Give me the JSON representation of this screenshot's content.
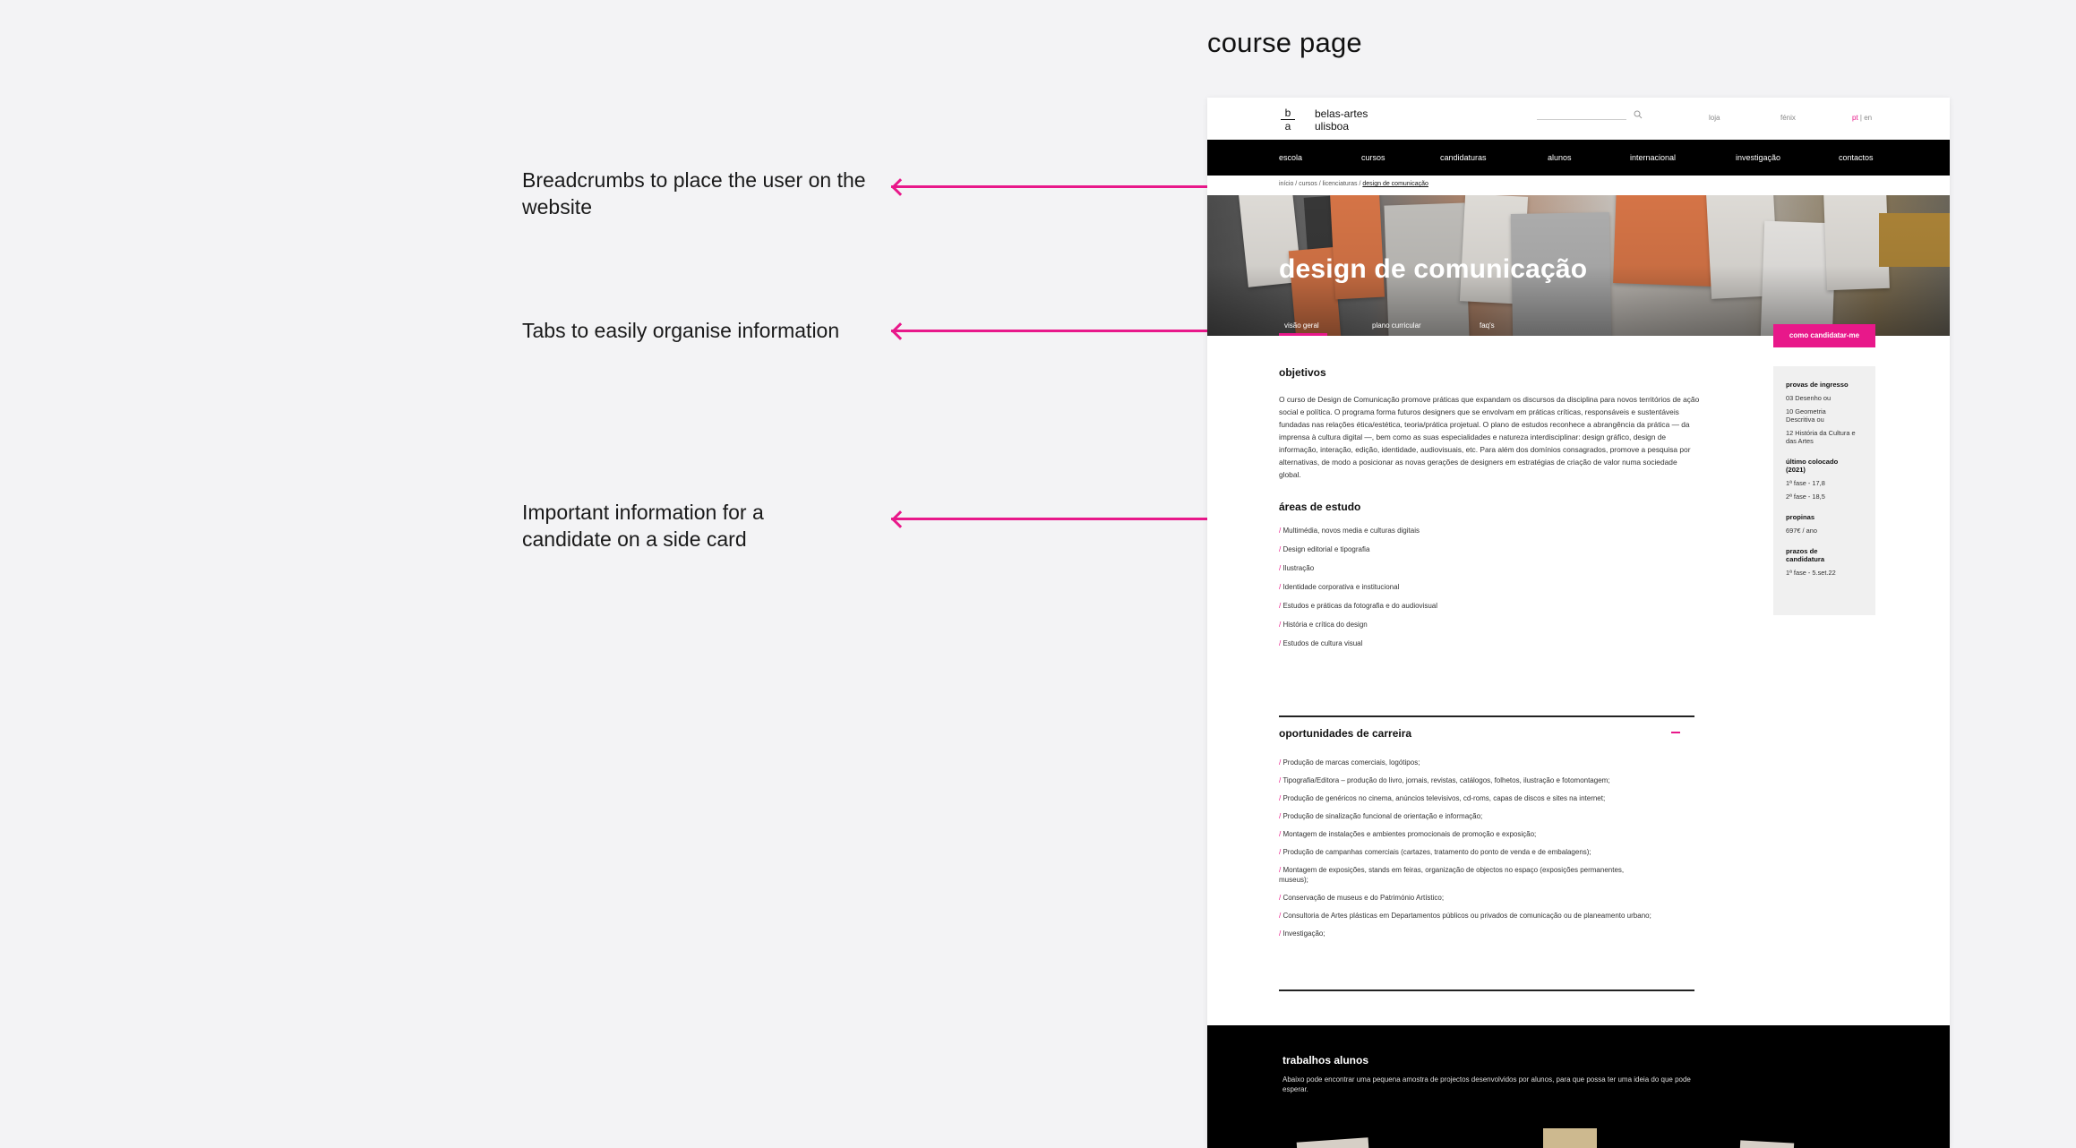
{
  "page_title": "course page",
  "annotations": [
    {
      "text": "Breadcrumbs to place the user on the website"
    },
    {
      "text": "Tabs to easily organise information"
    },
    {
      "text": "Important information for a candidate on a side card"
    }
  ],
  "colors": {
    "accent": "#e8188a",
    "nav_bg": "#000000",
    "page_bg": "#f3f3f5"
  },
  "site": {
    "logo_top": "b",
    "logo_bottom": "a",
    "brand_line1": "belas-artes",
    "brand_line2": "ulisboa",
    "top_links": [
      "loja",
      "fénix"
    ],
    "lang_active": "pt",
    "lang_sep": "|",
    "lang_other": "en"
  },
  "nav": [
    "escola",
    "cursos",
    "candidaturas",
    "alunos",
    "internacional",
    "investigação",
    "contactos"
  ],
  "breadcrumb": {
    "path": "início / cursos / licenciaturas / ",
    "current": "design de comunicação"
  },
  "hero": {
    "title": "design de comunicação",
    "tabs": [
      "visão geral",
      "plano curricular",
      "faq's"
    ],
    "cta": "como candidatar-me"
  },
  "objetivos": {
    "heading": "objetivos",
    "text": "O curso de Design de Comunicação promove práticas que expandam os discursos da disciplina para novos territórios de ação social e política. O programa forma futuros designers que se envolvam em práticas críticas, responsáveis e sustentáveis fundadas nas relações ética/estética, teoria/prática projetual. O plano de estudos reconhece a abrangência da prática — da imprensa à cultura digital —, bem como as suas especialidades e natureza interdisciplinar: design gráfico, design de informação, interação, edição, identidade, audiovisuais, etc. Para além dos domínios consagrados, promove a pesquisa por alternativas, de modo a posicionar as novas gerações de designers em estratégias de criação de valor numa sociedade global."
  },
  "areas": {
    "heading": "áreas de estudo",
    "items": [
      "Multimédia, novos media e culturas digitais",
      "Design editorial e tipografia",
      "Ilustração",
      "Identidade corporativa e institucional",
      "Estudos e práticas da fotografia e do audiovisual",
      "História e crítica do design",
      "Estudos de cultura visual"
    ]
  },
  "carreira": {
    "heading": "oportunidades de carreira",
    "items": [
      "Produção de marcas comerciais, logótipos;",
      "Tipografia/Editora – produção do livro, jornais, revistas, catálogos, folhetos, ilustração e fotomontagem;",
      "Produção de genéricos no cinema, anúncios televisivos, cd-roms, capas de discos e sites na internet;",
      "Produção de sinalização funcional de orientação e informação;",
      "Montagem de instalações e ambientes promocionais de promoção e exposição;",
      "Produção de campanhas comerciais (cartazes, tratamento do ponto de venda e de embalagens);",
      "Montagem de exposições, stands em feiras, organização de objectos no espaço (exposições permanentes, museus);",
      "Conservação de museus e do Património Artístico;",
      "Consultoria de Artes plásticas em Departamentos públicos ou privados de comunicação ou de planeamento urbano;",
      "Investigação;"
    ]
  },
  "side_card": {
    "provas_label": "provas de ingresso",
    "provas": [
      "03 Desenho ou",
      "10 Geometria Descritiva ou",
      "12 História da Cultura e das Artes"
    ],
    "ultimo_label": "último colocado (2021)",
    "ultimo": [
      "1ª fase - 17,8",
      "2ª fase - 18,5"
    ],
    "propinas_label": "propinas",
    "propinas": "697€ / ano",
    "prazos_label": "prazos de candidatura",
    "prazos": "1ª fase - 5.set.22"
  },
  "trabalhos": {
    "heading": "trabalhos alunos",
    "text": "Abaixo pode encontrar uma pequena amostra de projectos desenvolvidos por alunos, para que possa ter uma ideia do que pode esperar."
  }
}
